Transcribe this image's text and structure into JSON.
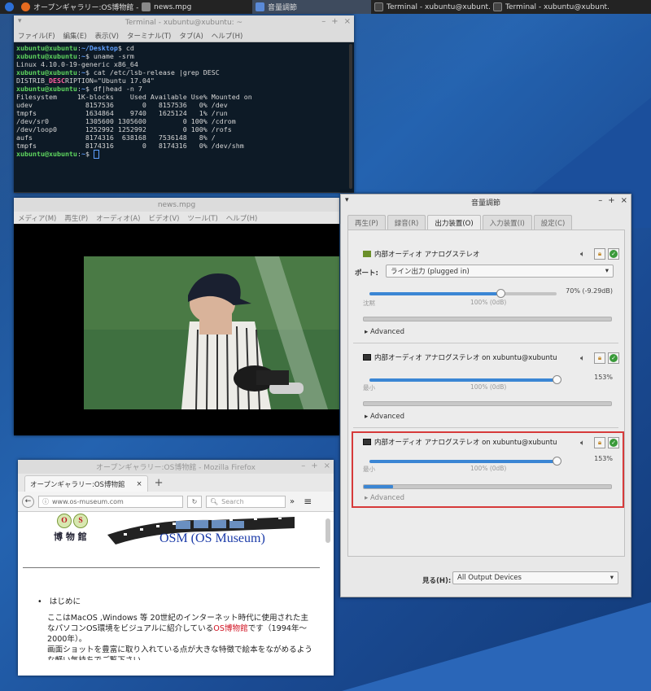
{
  "panel": {
    "tasks": [
      {
        "label": "オープンギャラリー:OS博物館 -...",
        "icon": "firefox-icon",
        "color": "#e66b1f"
      },
      {
        "label": "news.mpg",
        "icon": "video-icon",
        "color": "#888888"
      },
      {
        "label": "音量調節",
        "icon": "volume-icon",
        "color": "#5a8ad8"
      },
      {
        "label": "Terminal - xubuntu@xubunt...",
        "icon": "terminal-icon",
        "color": "#444444"
      },
      {
        "label": "Terminal - xubuntu@xubunt...",
        "icon": "terminal-icon",
        "color": "#444444"
      }
    ]
  },
  "terminal": {
    "title": "Terminal - xubuntu@xubuntu: ~",
    "menu": [
      "ファイル(F)",
      "編集(E)",
      "表示(V)",
      "ターミナル(T)",
      "タブ(A)",
      "ヘルプ(H)"
    ],
    "prompt_user": "xubuntu@xubuntu",
    "path_desktop": "~/Desktop",
    "path_home": "~",
    "cmd1": " cd",
    "cmd2": " uname -srm",
    "out_uname": "Linux 4.10.0-19-generic x86_64",
    "cmd3": " cat /etc/lsb-release |grep DESC",
    "desc_pre": "DISTRIB_",
    "desc_hl": "DESC",
    "desc_post": "RIPTION=\"Ubuntu 17.04\"",
    "cmd4": " df|head -n 7",
    "df_rows": [
      "Filesystem     1K-blocks    Used Available Use% Mounted on",
      "udev             8157536       0   8157536   0% /dev",
      "tmpfs            1634864    9740   1625124   1% /run",
      "/dev/sr0         1305600 1305600         0 100% /cdrom",
      "/dev/loop0       1252992 1252992         0 100% /rofs",
      "aufs             8174316  638168   7536148   8% /",
      "tmpfs            8174316       0   8174316   0% /dev/shm"
    ]
  },
  "video": {
    "title": "news.mpg",
    "menu": [
      "メディア(M)",
      "再生(P)",
      "オーディオ(A)",
      "ビデオ(V)",
      "ツール(T)",
      "ヘルプ(H)"
    ]
  },
  "firefox": {
    "title": "オープンギャラリー:OS博物館 - Mozilla Firefox",
    "tab_label": "オープンギャラリー:OS博物館",
    "url": "www.os-museum.com",
    "search_placeholder": "Search",
    "logo_letters": [
      "O",
      "S"
    ],
    "logo_kanji": "博 物 館",
    "site_title": "OSM (OS Museum)",
    "bullet": "はじめに",
    "para_1": "ここはMacOS ,Windows 等 20世紀のインターネット時代に使用された主なパソコンOS環境をビジュアルに紹介している",
    "para_link": "OS博物館",
    "para_2": "です（1994年～2000年）。",
    "para_3": "画面ショットを豊富に取り入れている点が大きな特徴で絵本をながめるような軽い気持ちでご覧下さい。"
  },
  "mixer": {
    "title": "音量調節",
    "tabs": [
      "再生(P)",
      "録音(R)",
      "出力装置(O)",
      "入力装置(I)",
      "設定(C)"
    ],
    "active_tab": 2,
    "devices": [
      {
        "name": "内部オーディオ アナログステレオ",
        "port_label": "ポート:",
        "port_value": "ライン出力 (plugged in)",
        "volume_text": "70% (-9.29dB)",
        "volume": 0.7,
        "tick_left": "沈黙",
        "tick_mid": "100% (0dB)",
        "meter": 0.0,
        "advanced": "Advanced"
      },
      {
        "name": "内部オーディオ アナログステレオ on xubuntu@xubuntu",
        "volume_text": "153%",
        "volume": 1.0,
        "tick_left": "最小",
        "tick_mid": "100% (0dB)",
        "meter": 0.0,
        "advanced": "Advanced"
      },
      {
        "name": "内部オーディオ アナログステレオ on xubuntu@xubuntu",
        "volume_text": "153%",
        "volume": 1.0,
        "tick_left": "最小",
        "tick_mid": "100% (0dB)",
        "meter": 0.12,
        "advanced": "Advanced"
      }
    ],
    "show_label": "見る(H):",
    "show_value": "All Output Devices"
  }
}
